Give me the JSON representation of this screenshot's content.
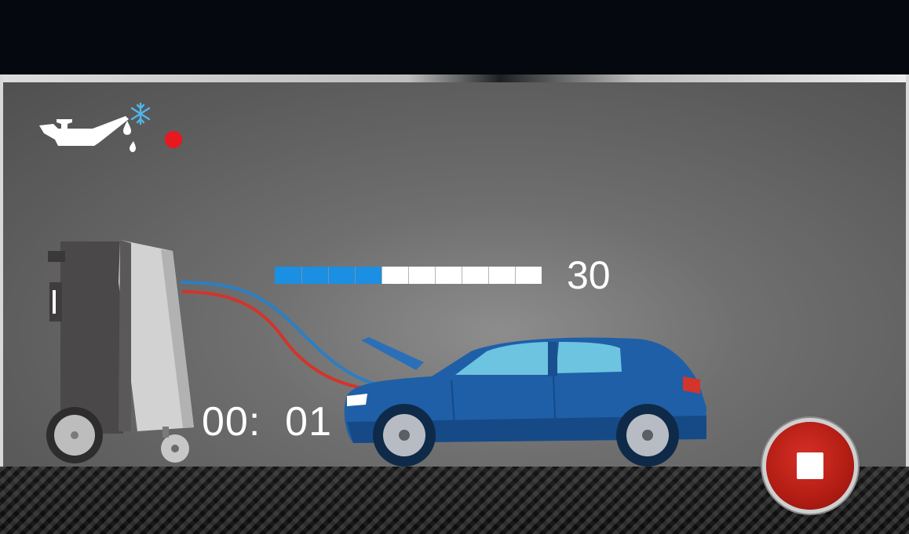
{
  "status": {
    "oil_icon": "oil-can-refrigerant-icon",
    "indicator_color": "#e8181e"
  },
  "progress": {
    "fraction": 0.4,
    "segments": 10,
    "value": "30",
    "fill_color": "#1b8fe2"
  },
  "timer": {
    "text": "00:  01"
  },
  "controls": {
    "stop_icon": "stop-icon",
    "stop_color": "#b51e15"
  },
  "illustration": {
    "machine": "ac-service-machine-icon",
    "car": "car-icon",
    "car_color": "#1f5fa8"
  }
}
